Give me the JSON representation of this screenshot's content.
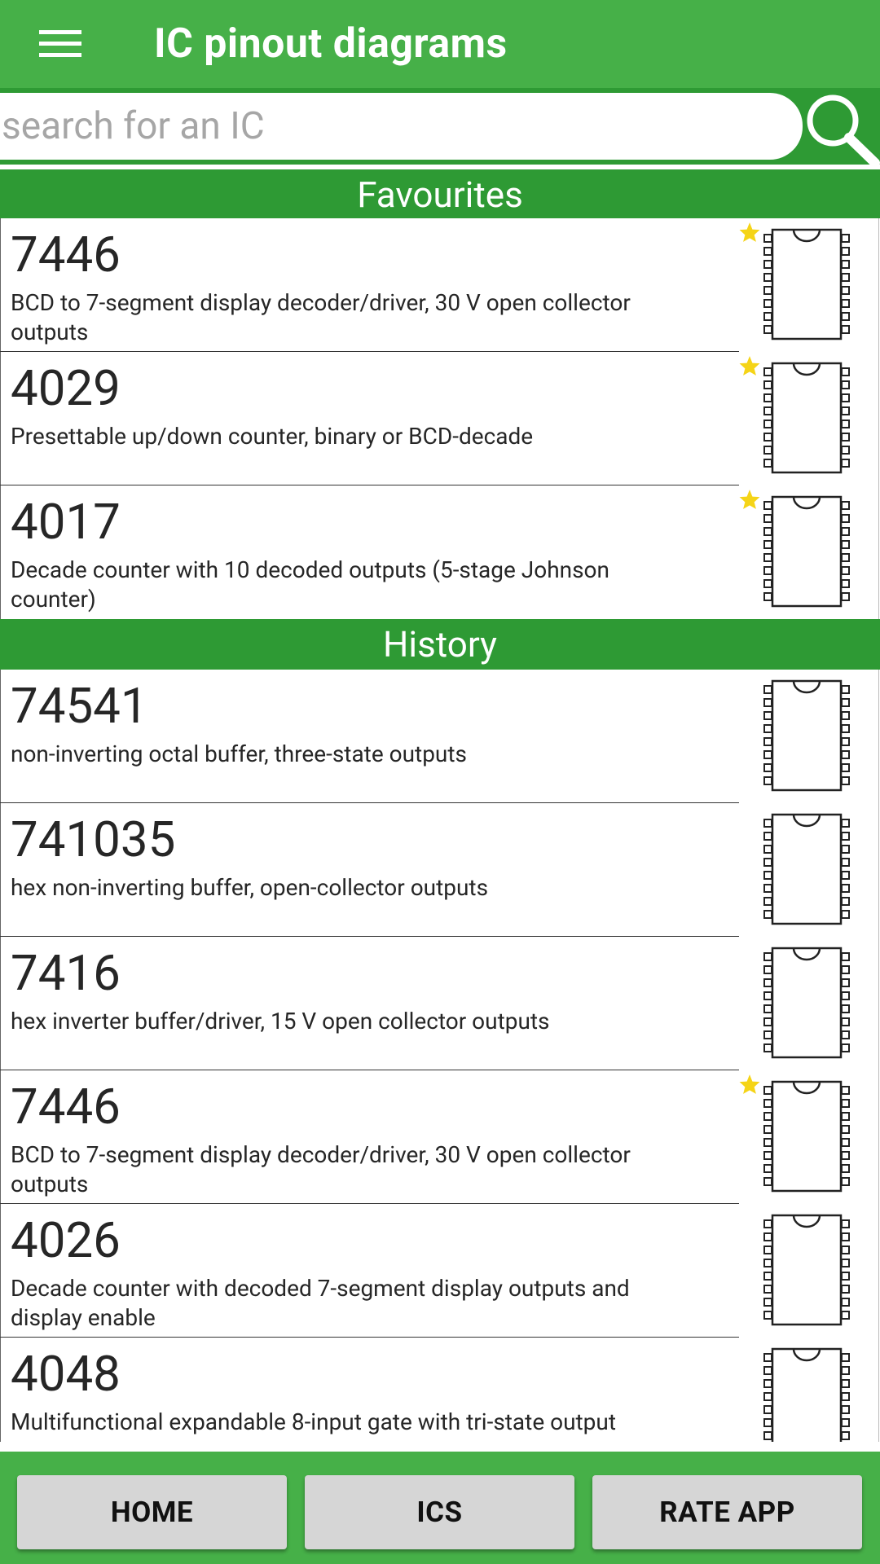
{
  "app": {
    "title": "IC pinout diagrams"
  },
  "search": {
    "placeholder": "search for an IC",
    "value": ""
  },
  "sections": {
    "favourites": "Favourites",
    "history": "History"
  },
  "favourites": [
    {
      "number": "7446",
      "description": "BCD to 7-segment display decoder/driver, 30 V open collector outputs",
      "starred": true
    },
    {
      "number": "4029",
      "description": "Presettable up/down counter, binary or BCD-decade",
      "starred": true
    },
    {
      "number": "4017",
      "description": "Decade counter with 10 decoded outputs (5-stage Johnson counter)",
      "starred": true
    }
  ],
  "history": [
    {
      "number": "74541",
      "description": "non-inverting octal buffer, three-state outputs",
      "starred": false
    },
    {
      "number": "741035",
      "description": "hex non-inverting buffer, open-collector outputs",
      "starred": false
    },
    {
      "number": "7416",
      "description": "hex inverter buffer/driver, 15 V open collector outputs",
      "starred": false
    },
    {
      "number": "7446",
      "description": "BCD to 7-segment display decoder/driver, 30 V open collector outputs",
      "starred": true
    },
    {
      "number": "4026",
      "description": "Decade counter with decoded 7-segment display outputs and display enable",
      "starred": false
    },
    {
      "number": "4048",
      "description": "Multifunctional expandable 8-input gate with tri-state output",
      "starred": false
    }
  ],
  "bottom_nav": {
    "home": "HOME",
    "ics": "ICS",
    "rate": "RATE APP"
  },
  "icons": {
    "menu": "hamburger-menu-icon",
    "search": "magnifier-icon",
    "star": "star-icon",
    "chip": "dip-chip-icon"
  },
  "colors": {
    "primary": "#46b048",
    "section": "#2e9a34",
    "star": "#f5d417",
    "button": "#d6d6d6"
  }
}
